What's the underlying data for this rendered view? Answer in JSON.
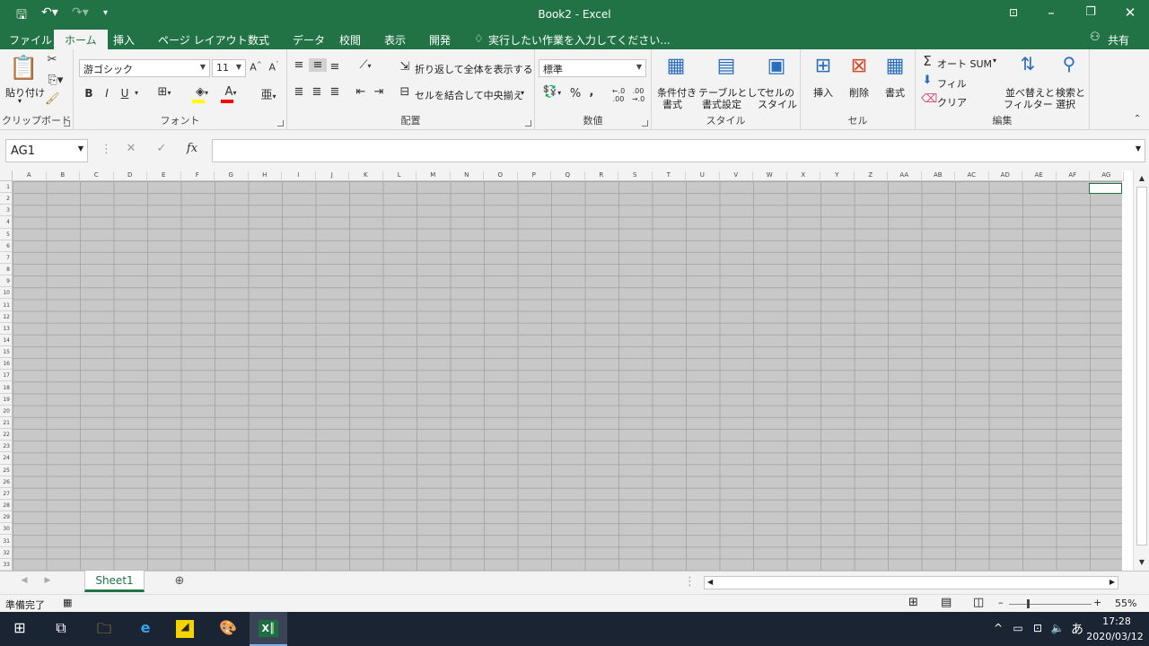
{
  "title": "Book2 - Excel",
  "tabs": [
    "ファイル",
    "ホーム",
    "挿入",
    "ページ レイアウト",
    "数式",
    "データ",
    "校閲",
    "表示",
    "開発"
  ],
  "tellme": "実行したい作業を入力してください...",
  "share": "共有",
  "clipboard": {
    "paste": "貼り付け",
    "label": "クリップボード"
  },
  "font": {
    "name": "游ゴシック",
    "size": "11",
    "label": "フォント",
    "bold": "B",
    "italic": "I",
    "underline": "U"
  },
  "align": {
    "wrap": "折り返して全体を表示する",
    "merge": "セルを結合して中央揃え",
    "label": "配置"
  },
  "number": {
    "format": "標準",
    "label": "数値",
    "percent": "%",
    "comma": ","
  },
  "style": {
    "cond1": "条件付き",
    "cond2": "書式",
    "table1": "テーブルとして",
    "table2": "書式設定",
    "cell1": "セルの",
    "cell2": "スタイル",
    "label": "スタイル"
  },
  "cells": {
    "insert": "挿入",
    "delete": "削除",
    "format": "書式",
    "label": "セル"
  },
  "edit": {
    "autosum": "オート SUM",
    "fill": "フィル",
    "clear": "クリア",
    "sort1": "並べ替えと",
    "sort2": "フィルター",
    "find1": "検索と",
    "find2": "選択",
    "label": "編集"
  },
  "namebox": "AG1",
  "fxsymbol": "fx",
  "columns": [
    "A",
    "B",
    "C",
    "D",
    "E",
    "F",
    "G",
    "H",
    "I",
    "J",
    "K",
    "L",
    "M",
    "N",
    "O",
    "P",
    "Q",
    "R",
    "S",
    "T",
    "U",
    "V",
    "W",
    "X",
    "Y",
    "Z",
    "AA",
    "AB",
    "AC",
    "AD",
    "AE",
    "AF",
    "AG"
  ],
  "rows": [
    "1",
    "2",
    "3",
    "4",
    "5",
    "6",
    "7",
    "8",
    "9",
    "10",
    "11",
    "12",
    "13",
    "14",
    "15",
    "16",
    "17",
    "18",
    "19",
    "20",
    "21",
    "22",
    "23",
    "24",
    "25",
    "26",
    "27",
    "28",
    "29",
    "30",
    "31",
    "32",
    "33"
  ],
  "sheet": "Sheet1",
  "status": "準備完了",
  "zoom": "55%",
  "time": "17:28",
  "date": "2020/03/12",
  "ime": "あ",
  "colors": {
    "brand": "#217346",
    "font_color": "#ff0000",
    "highlight": "#ffff00"
  }
}
